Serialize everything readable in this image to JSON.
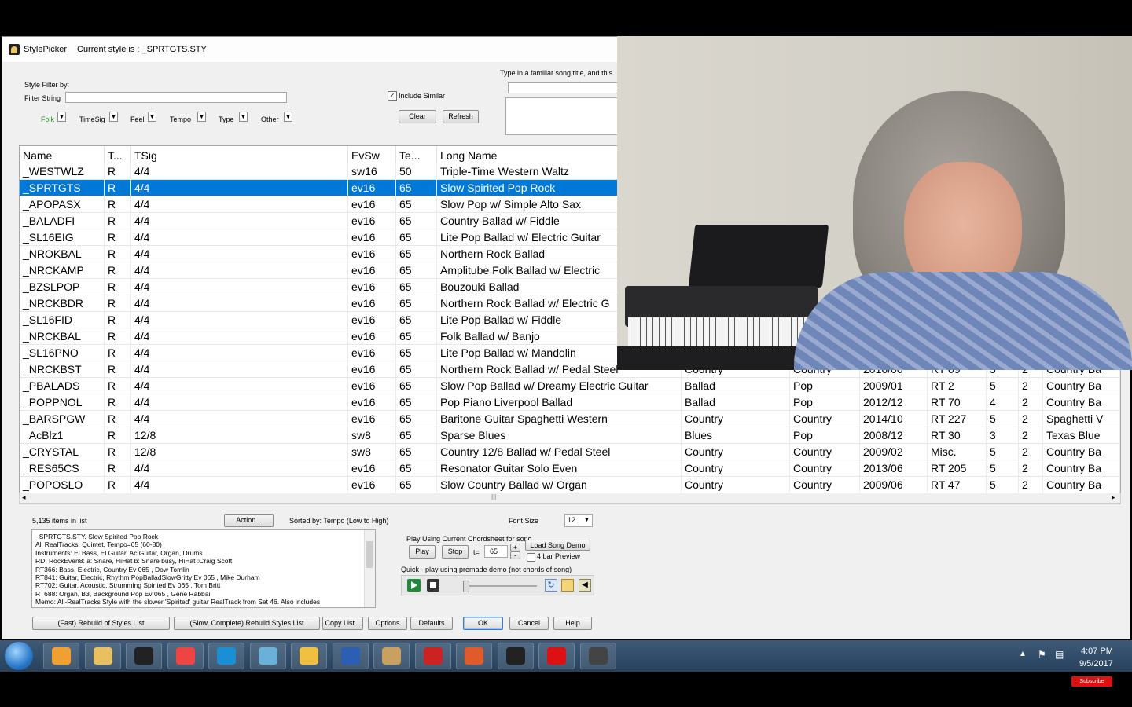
{
  "dialog": {
    "app_title": "StylePicker",
    "current_style": "Current style is : _SPRTGTS.STY",
    "filter": {
      "group_label": "Style Filter by:",
      "string_label": "Filter String",
      "string_value": "",
      "include_similar_label": "Include Similar",
      "include_similar_checked": true,
      "clear_label": "Clear",
      "refresh_label": "Refresh",
      "dropdowns": [
        "Folk",
        "TimeSig",
        "Feel",
        "Tempo",
        "Type",
        "Other"
      ]
    },
    "song_title_hint": "Type in a familiar song title, and this",
    "columns": [
      "Name",
      "T...",
      "TSig",
      "EvSw",
      "Te...",
      "Long Name",
      "",
      "",
      "",
      "",
      "",
      "",
      ""
    ],
    "rows": [
      [
        "_WESTWLZ",
        "R",
        "4/4",
        "sw16",
        "50",
        "Triple-Time Western Waltz",
        "",
        "",
        "",
        "",
        "",
        "",
        ""
      ],
      [
        "_SPRTGTS",
        "R",
        "4/4",
        "ev16",
        "65",
        "Slow Spirited Pop Rock",
        "",
        "",
        "",
        "",
        "",
        "",
        ""
      ],
      [
        "_APOPASX",
        "R",
        "4/4",
        "ev16",
        "65",
        "Slow Pop w/ Simple Alto Sax",
        "",
        "",
        "",
        "",
        "",
        "",
        ""
      ],
      [
        "_BALADFI",
        "R",
        "4/4",
        "ev16",
        "65",
        "Country Ballad w/ Fiddle",
        "",
        "",
        "",
        "",
        "",
        "",
        ""
      ],
      [
        "_SL16EIG",
        "R",
        "4/4",
        "ev16",
        "65",
        "Lite Pop Ballad w/ Electric Guitar",
        "",
        "",
        "",
        "",
        "",
        "",
        ""
      ],
      [
        "_NROKBAL",
        "R",
        "4/4",
        "ev16",
        "65",
        "Northern Rock Ballad",
        "",
        "",
        "",
        "",
        "",
        "",
        ""
      ],
      [
        "_NRCKAMP",
        "R",
        "4/4",
        "ev16",
        "65",
        "Amplitube Folk Ballad w/ Electric",
        "",
        "",
        "",
        "",
        "",
        "",
        ""
      ],
      [
        "_BZSLPOP",
        "R",
        "4/4",
        "ev16",
        "65",
        "Bouzouki Ballad",
        "",
        "",
        "",
        "",
        "",
        "",
        ""
      ],
      [
        "_NRCKBDR",
        "R",
        "4/4",
        "ev16",
        "65",
        "Northern Rock Ballad w/ Electric G",
        "",
        "",
        "",
        "",
        "",
        "",
        ""
      ],
      [
        "_SL16FID",
        "R",
        "4/4",
        "ev16",
        "65",
        "Lite Pop Ballad w/ Fiddle",
        "",
        "",
        "",
        "",
        "",
        "",
        ""
      ],
      [
        "_NRCKBAL",
        "R",
        "4/4",
        "ev16",
        "65",
        "Folk Ballad w/ Banjo",
        "",
        "",
        "",
        "",
        "",
        "",
        ""
      ],
      [
        "_SL16PNO",
        "R",
        "4/4",
        "ev16",
        "65",
        "Lite Pop Ballad w/ Mandolin",
        "",
        "",
        "",
        "",
        "",
        "",
        ""
      ],
      [
        "_NRCKBST",
        "R",
        "4/4",
        "ev16",
        "65",
        "Northern Rock Ballad w/ Pedal Steel",
        "Country",
        "Country",
        "2016/00",
        "RT 09",
        "5",
        "2",
        "Country Ba"
      ],
      [
        "_PBALADS",
        "R",
        "4/4",
        "ev16",
        "65",
        "Slow Pop Ballad w/ Dreamy Electric Guitar",
        "Ballad",
        "Pop",
        "2009/01",
        "RT 2",
        "5",
        "2",
        "Country Ba"
      ],
      [
        "_POPPNOL",
        "R",
        "4/4",
        "ev16",
        "65",
        "Pop Piano Liverpool Ballad",
        "Ballad",
        "Pop",
        "2012/12",
        "RT 70",
        "4",
        "2",
        "Country Ba"
      ],
      [
        "_BARSPGW",
        "R",
        "4/4",
        "ev16",
        "65",
        "Baritone Guitar Spaghetti Western",
        "Country",
        "Country",
        "2014/10",
        "RT 227",
        "5",
        "2",
        "Spaghetti V"
      ],
      [
        "_AcBlz1",
        "R",
        "12/8",
        "sw8",
        "65",
        "Sparse Blues",
        "Blues",
        "Pop",
        "2008/12",
        "RT 30",
        "3",
        "2",
        "Texas Blue"
      ],
      [
        "_CRYSTAL",
        "R",
        "12/8",
        "sw8",
        "65",
        "Country 12/8 Ballad w/ Pedal Steel",
        "Country",
        "Country",
        "2009/02",
        "Misc.",
        "5",
        "2",
        "Country Ba"
      ],
      [
        "_RES65CS",
        "R",
        "4/4",
        "ev16",
        "65",
        "Resonator Guitar Solo Even",
        "Country",
        "Country",
        "2013/06",
        "RT 205",
        "5",
        "2",
        "Country Ba"
      ],
      [
        "_POPOSLO",
        "R",
        "4/4",
        "ev16",
        "65",
        "Slow Country Ballad w/ Organ",
        "Country",
        "Country",
        "2009/06",
        "RT 47",
        "5",
        "2",
        "Country Ba"
      ]
    ],
    "selected_row": 1,
    "items_count": "5,135 items in list",
    "action_label": "Action...",
    "sorted_by": "Sorted by: Tempo  (Low to High)",
    "font_size_label": "Font Size",
    "font_size_value": "12",
    "info_lines": [
      "_SPRTGTS.STY. Slow Spirited Pop Rock",
      "All RealTracks. Quintet. Tempo=65 (60-80)",
      "Instruments: El.Bass, El.Guitar, Ac.Guitar, Organ, Drums",
      "RD: RockEven8: a: Snare, HiHat  b: Snare busy, HiHat  :Craig Scott",
      "RT366: Bass, Electric, Country Ev 065 , Dow Tomlin",
      "RT841: Guitar, Electric, Rhythm PopBalladSlowGritty Ev 065 , Mike Durham",
      "RT702: Guitar, Acoustic, Strumming Spirited Ev 065 , Tom Britt",
      "RT688: Organ, B3, Background Pop Ev 065 , Gene Rabbai",
      "Memo: All-RealTracks Style with the slower 'Spirited' guitar RealTrack  from Set 46. Also includes"
    ],
    "play_group_label": "Play Using Current Chordsheet for song",
    "play_label": "Play",
    "stop_label": "Stop",
    "tempo_prefix": "t=",
    "tempo_value": "65",
    "plus_label": "+",
    "minus_label": "-",
    "load_demo_label": "Load Song Demo",
    "four_bar_label": "4 bar Preview",
    "quick_label": "Quick - play using premade demo (not chords of song)",
    "bottom_buttons": [
      "(Fast) Rebuild of Styles List",
      "(Slow, Complete) Rebuild Styles List",
      "Copy List...",
      "Options",
      "Defaults",
      "OK",
      "Cancel",
      "Help"
    ]
  },
  "webcam": {
    "description": ""
  },
  "taskbar": {
    "time": "4:07 PM",
    "date": "9/5/2017",
    "subscribe": "Subscribe",
    "apps": [
      "start-orb-icon",
      "media-player-icon",
      "file-explorer-icon",
      "winamp-icon",
      "chrome-icon",
      "skype-icon",
      "sketchbook-icon",
      "outlook-icon",
      "word-icon",
      "paint-icon",
      "band-in-a-box-icon",
      "powerpoint-icon",
      "audio-icon",
      "record-icon",
      "stylepicker-icon"
    ]
  }
}
